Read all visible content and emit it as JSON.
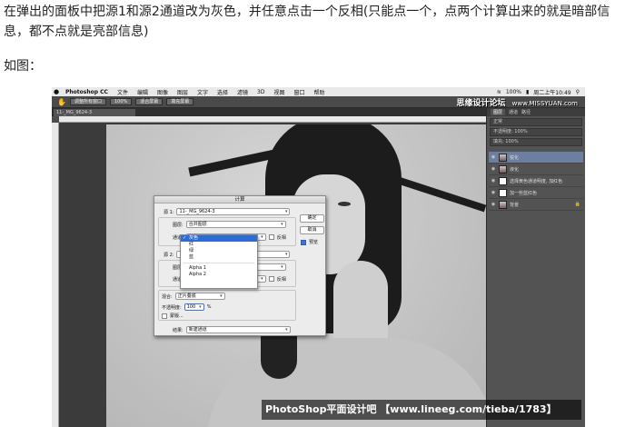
{
  "article": {
    "instruction": "在弹出的面板中把源1和源2通道改为灰色，并任意点击一个反相(只能点一个，点两个计算出来的就是暗部信息，都不点就是亮部信息)",
    "caption": "如图："
  },
  "photoshop": {
    "menubar": {
      "apple": "",
      "app_name": "Photoshop CC",
      "items": [
        "文件",
        "编辑",
        "图像",
        "图层",
        "文字",
        "选择",
        "滤镜",
        "3D",
        "视图",
        "窗口",
        "帮助"
      ],
      "battery": "100%",
      "clock": "周二上午10:49"
    },
    "options_bar": {
      "buttons": [
        "调整所有窗口",
        "100%",
        "适合屏幕",
        "填充屏幕"
      ]
    },
    "watermark_top": {
      "name": "思缘设计论坛",
      "url": "www.MISSYUAN.com"
    },
    "panels": {
      "tabs": [
        "图层",
        "通道",
        "路径"
      ],
      "blend_mode": "正常",
      "opacity_label": "不透明度: 100%",
      "fill_label": "填充: 100%",
      "layers": [
        {
          "name": "锐化",
          "thumb": "photo",
          "selected": true
        },
        {
          "name": "液化",
          "thumb": "photo",
          "selected": false
        },
        {
          "name": "选择黄色通道明度, 加红色",
          "thumb": "white",
          "selected": false
        },
        {
          "name": "加一些蓝红色",
          "thumb": "white",
          "selected": false
        },
        {
          "name": "背景",
          "thumb": "photo",
          "selected": false
        }
      ]
    },
    "dialog": {
      "title": "计算",
      "source1_label": "源 1:",
      "source1_value": "11-_MG_9624-3",
      "layer1_label": "图层:",
      "layer1_value": "合并图层",
      "channel1_label": "通道:",
      "invert1_label": "反相",
      "source2_label": "源 2:",
      "layer2_label": "图层:",
      "channel2_label": "通道:",
      "invert2_label": "反相",
      "blending_label": "混合:",
      "blending_value": "正片叠底",
      "opacity_label": "不透明度:",
      "opacity_value": "100",
      "opacity_unit": "%",
      "mask_label": "蒙版...",
      "result_label": "结果:",
      "result_value": "新建通道",
      "ok_label": "确定",
      "cancel_label": "取消",
      "preview_label": "预览"
    },
    "channel_dropdown": {
      "items": [
        "灰色",
        "红",
        "绿",
        "蓝"
      ],
      "alpha_items": [
        "Alpha 1",
        "Alpha 2"
      ]
    },
    "watermark_bottom": "PhotoShop平面设计吧 【www.lineeg.com/tieba/1783】"
  }
}
